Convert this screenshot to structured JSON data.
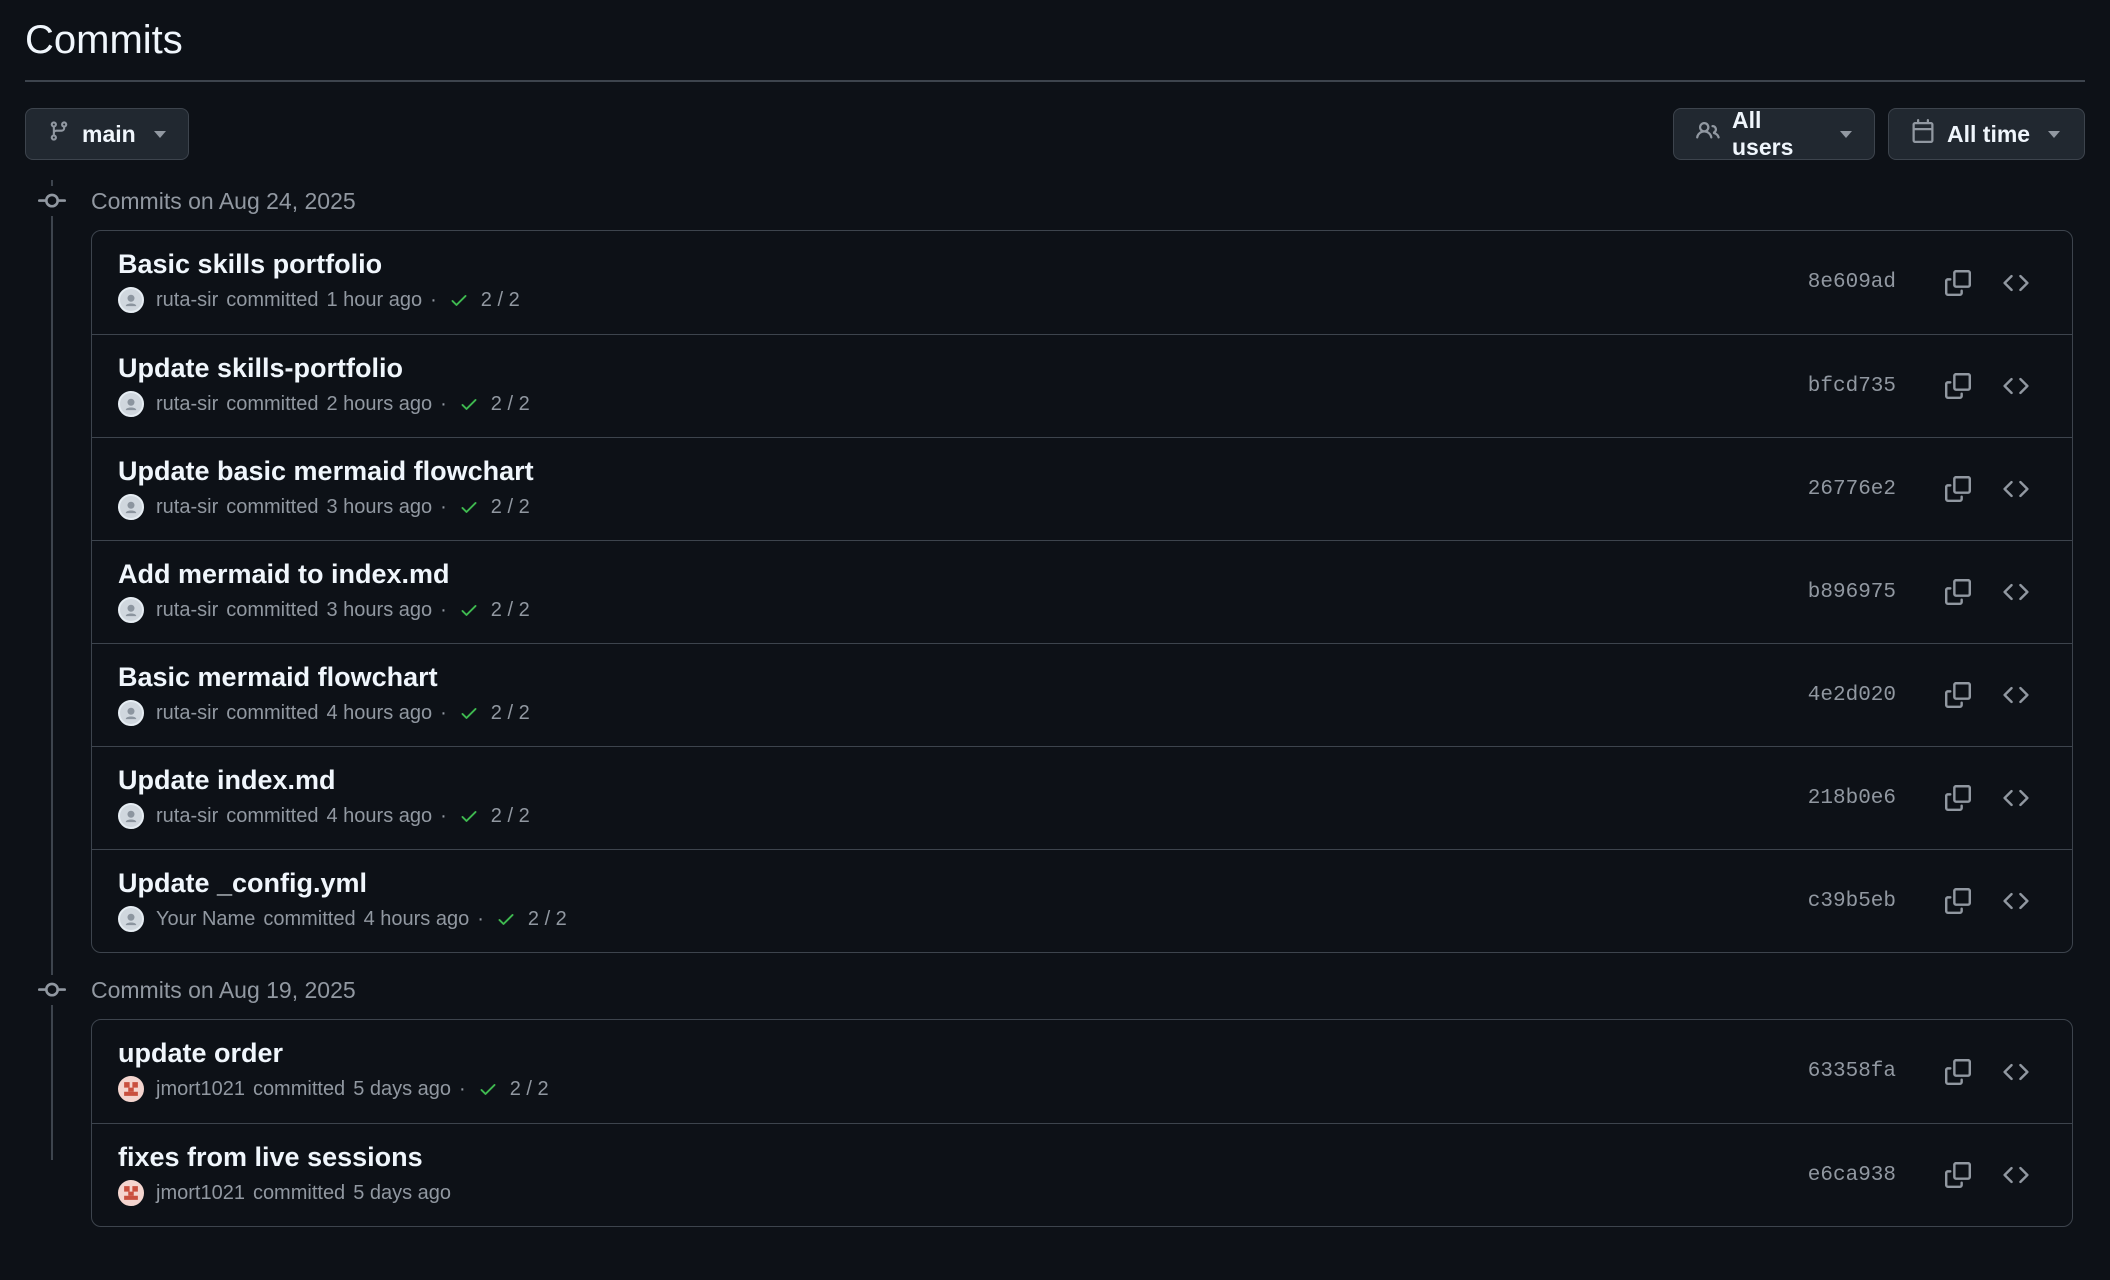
{
  "page_title": "Commits",
  "branch_button": {
    "label": "main",
    "icon": "git-branch-icon"
  },
  "users_filter": {
    "label": "All users",
    "icon": "people-icon"
  },
  "time_filter": {
    "label": "All time",
    "icon": "calendar-icon"
  },
  "colors": {
    "background": "#0d1117",
    "border": "#3d444d",
    "success": "#3fb950",
    "muted": "#9198a1"
  },
  "groups": [
    {
      "header": "Commits on Aug 24, 2025",
      "commits": [
        {
          "title": "Basic skills portfolio",
          "author": "ruta-sir",
          "verb": "committed",
          "time": "1 hour ago",
          "checks": "2 / 2",
          "sha": "8e609ad"
        },
        {
          "title": "Update skills-portfolio",
          "author": "ruta-sir",
          "verb": "committed",
          "time": "2 hours ago",
          "checks": "2 / 2",
          "sha": "bfcd735"
        },
        {
          "title": "Update basic mermaid flowchart",
          "author": "ruta-sir",
          "verb": "committed",
          "time": "3 hours ago",
          "checks": "2 / 2",
          "sha": "26776e2"
        },
        {
          "title": "Add mermaid to index.md",
          "author": "ruta-sir",
          "verb": "committed",
          "time": "3 hours ago",
          "checks": "2 / 2",
          "sha": "b896975"
        },
        {
          "title": "Basic mermaid flowchart",
          "author": "ruta-sir",
          "verb": "committed",
          "time": "4 hours ago",
          "checks": "2 / 2",
          "sha": "4e2d020"
        },
        {
          "title": "Update index.md",
          "author": "ruta-sir",
          "verb": "committed",
          "time": "4 hours ago",
          "checks": "2 / 2",
          "sha": "218b0e6"
        },
        {
          "title": "Update _config.yml",
          "author": "Your Name",
          "verb": "committed",
          "time": "4 hours ago",
          "checks": "2 / 2",
          "sha": "c39b5eb"
        }
      ]
    },
    {
      "header": "Commits on Aug 19, 2025",
      "commits": [
        {
          "title": "update order",
          "author": "jmort1021",
          "verb": "committed",
          "time": "5 days ago",
          "checks": "2 / 2",
          "sha": "63358fa"
        },
        {
          "title": "fixes from live sessions",
          "author": "jmort1021",
          "verb": "committed",
          "time": "5 days ago",
          "checks": "",
          "sha": "e6ca938"
        }
      ]
    }
  ]
}
